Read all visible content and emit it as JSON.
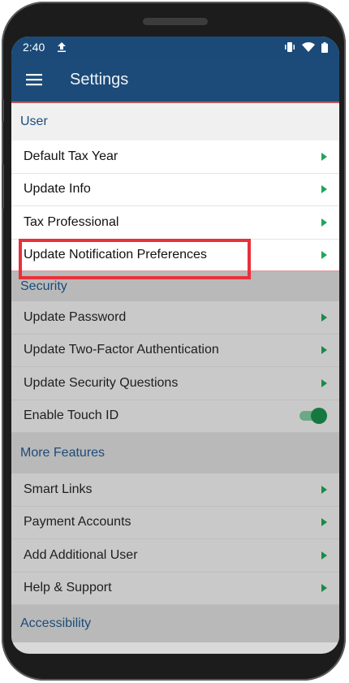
{
  "status_bar": {
    "time": "2:40"
  },
  "app_bar": {
    "title": "Settings"
  },
  "sections": {
    "user": {
      "header": "User",
      "items": [
        "Default Tax Year",
        "Update Info",
        "Tax Professional",
        "Update Notification Preferences"
      ]
    },
    "security": {
      "header": "Security",
      "items": [
        "Update Password",
        "Update Two-Factor Authentication",
        "Update Security Questions"
      ],
      "toggle_label": "Enable Touch ID",
      "toggle_on": true
    },
    "more_features": {
      "header": "More Features",
      "items": [
        "Smart Links",
        "Payment Accounts",
        "Add Additional User",
        "Help & Support"
      ]
    },
    "accessibility": {
      "header": "Accessibility"
    }
  },
  "colors": {
    "primary": "#1c4b79",
    "chevron": "#1fa55a",
    "highlight": "#e8303a",
    "toggle": "#15793f"
  }
}
